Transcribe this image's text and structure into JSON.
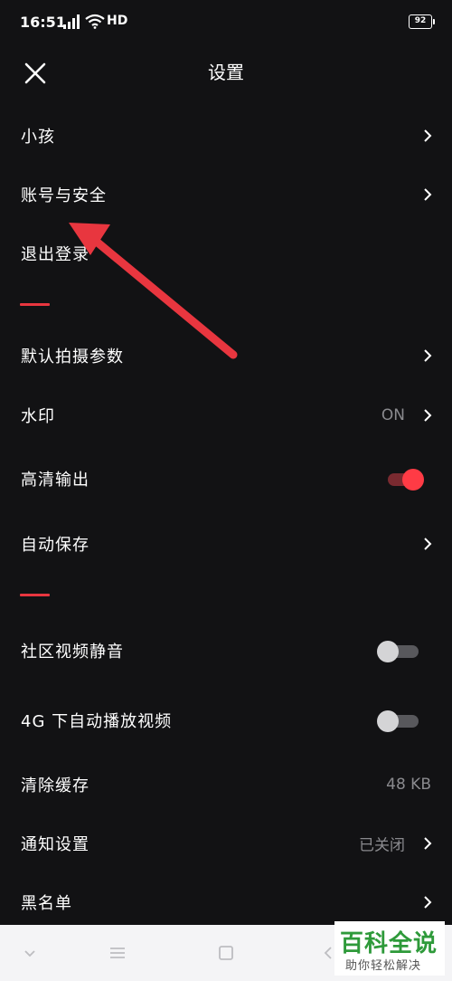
{
  "status_bar": {
    "time": "16:51",
    "network": "HD",
    "battery": "92"
  },
  "header": {
    "title": "设置"
  },
  "settings": [
    {
      "label": "小孩"
    },
    {
      "label": "账号与安全"
    },
    {
      "label": "退出登录"
    },
    {
      "label": "默认拍摄参数"
    },
    {
      "label": "水印",
      "value": "ON"
    },
    {
      "label": "高清输出",
      "toggle": true
    },
    {
      "label": "自动保存"
    },
    {
      "label": "社区视频静音",
      "toggle": false
    },
    {
      "label": "4G 下自动播放视频",
      "toggle": false
    },
    {
      "label": "清除缓存",
      "value": "48 KB"
    },
    {
      "label": "通知设置",
      "value": "已关闭"
    },
    {
      "label": "黑名单"
    }
  ],
  "watermark": {
    "title": "百科全说",
    "subtitle": "助你轻松解决"
  },
  "colors": {
    "accent": "#e8363f",
    "background": "#121214"
  }
}
